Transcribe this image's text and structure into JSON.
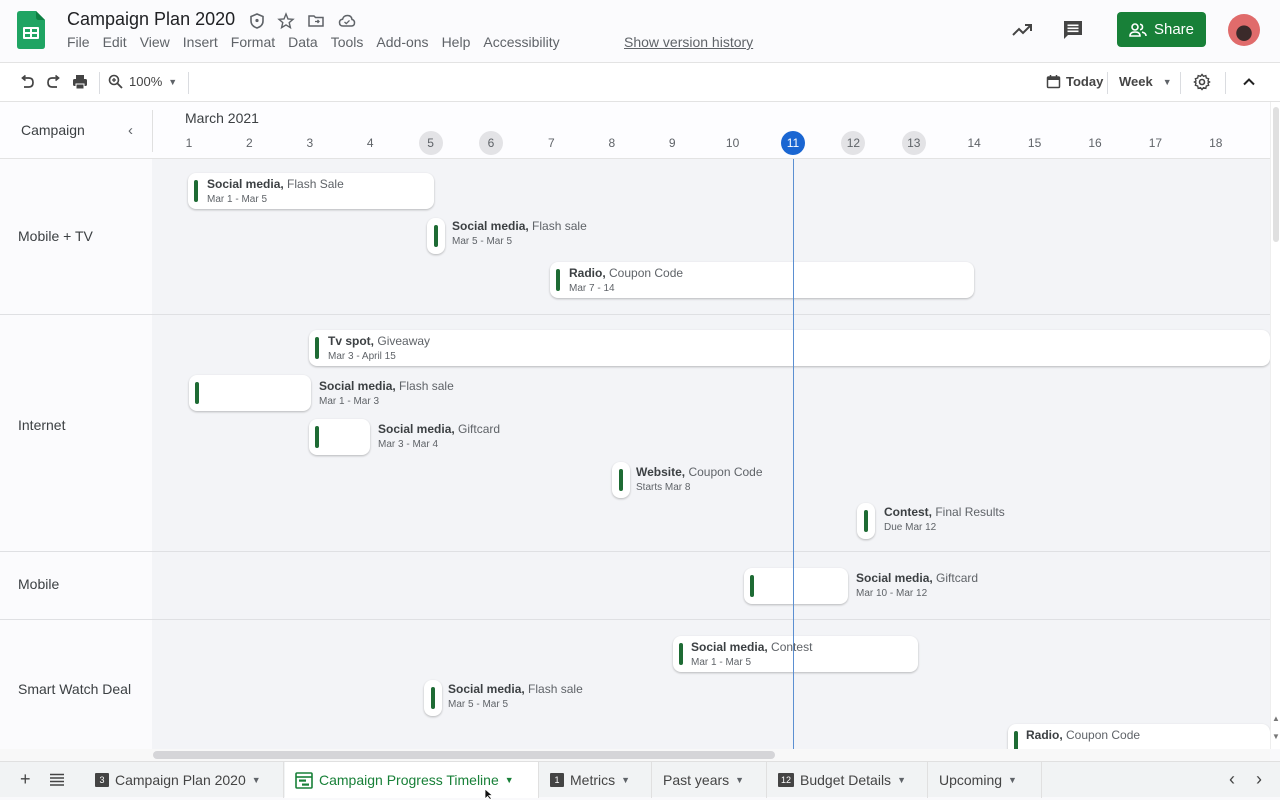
{
  "app": {
    "doc_title": "Campaign Plan 2020",
    "menu": [
      "File",
      "Edit",
      "View",
      "Insert",
      "Format",
      "Data",
      "Tools",
      "Add-ons",
      "Help",
      "Accessibility"
    ],
    "version_history": "Show version history",
    "share_label": "Share",
    "brand_color": "#188038"
  },
  "toolbar": {
    "zoom": "100%",
    "today_label": "Today",
    "view_label": "Week"
  },
  "timeline": {
    "column_header": "Campaign",
    "month": "March 2021",
    "days": [
      {
        "label": "1",
        "type": "normal"
      },
      {
        "label": "2",
        "type": "normal"
      },
      {
        "label": "3",
        "type": "normal"
      },
      {
        "label": "4",
        "type": "normal"
      },
      {
        "label": "5",
        "type": "weekend"
      },
      {
        "label": "6",
        "type": "weekend"
      },
      {
        "label": "7",
        "type": "normal"
      },
      {
        "label": "8",
        "type": "normal"
      },
      {
        "label": "9",
        "type": "normal"
      },
      {
        "label": "10",
        "type": "normal"
      },
      {
        "label": "11",
        "type": "today"
      },
      {
        "label": "12",
        "type": "weekend"
      },
      {
        "label": "13",
        "type": "weekend"
      },
      {
        "label": "14",
        "type": "normal"
      },
      {
        "label": "15",
        "type": "normal"
      },
      {
        "label": "16",
        "type": "normal"
      },
      {
        "label": "17",
        "type": "normal"
      },
      {
        "label": "18",
        "type": "normal"
      }
    ],
    "today_day": 11,
    "groups": [
      {
        "label": "Mobile + TV",
        "events": [
          {
            "channel": "Social media,",
            "name": "Flash Sale",
            "dates": "Mar 1 - Mar 5"
          },
          {
            "channel": "Social media,",
            "name": "Flash sale",
            "dates": "Mar 5 - Mar 5"
          },
          {
            "channel": "Radio,",
            "name": "Coupon Code",
            "dates": "Mar 7 - 14"
          }
        ]
      },
      {
        "label": "Internet",
        "events": [
          {
            "channel": "Tv spot,",
            "name": "Giveaway",
            "dates": "Mar 3 - April 15"
          },
          {
            "channel": "Social media,",
            "name": "Flash sale",
            "dates": "Mar 1 - Mar 3"
          },
          {
            "channel": "Social media,",
            "name": "Giftcard",
            "dates": "Mar 3 - Mar 4"
          },
          {
            "channel": "Website,",
            "name": "Coupon Code",
            "dates": "Starts Mar 8"
          },
          {
            "channel": "Contest,",
            "name": "Final Results",
            "dates": "Due Mar 12"
          }
        ]
      },
      {
        "label": "Mobile",
        "events": [
          {
            "channel": "Social media,",
            "name": "Giftcard",
            "dates": "Mar 10 - Mar 12"
          }
        ]
      },
      {
        "label": "Smart Watch Deal",
        "events": [
          {
            "channel": "Social media,",
            "name": "Contest",
            "dates": "Mar 1 - Mar 5"
          },
          {
            "channel": "Social media,",
            "name": "Flash sale",
            "dates": "Mar 5 - Mar 5"
          },
          {
            "channel": "Radio,",
            "name": "Coupon Code",
            "dates": ""
          }
        ]
      }
    ]
  },
  "sheets": [
    {
      "label": "Campaign Plan 2020",
      "badge": "3",
      "active": false
    },
    {
      "label": "Campaign Progress Timeline",
      "badge": "",
      "active": true
    },
    {
      "label": "Metrics",
      "badge": "1",
      "active": false
    },
    {
      "label": "Past years",
      "badge": "",
      "active": false
    },
    {
      "label": "Budget Details",
      "badge": "12",
      "active": false
    },
    {
      "label": "Upcoming",
      "badge": "",
      "active": false
    }
  ]
}
